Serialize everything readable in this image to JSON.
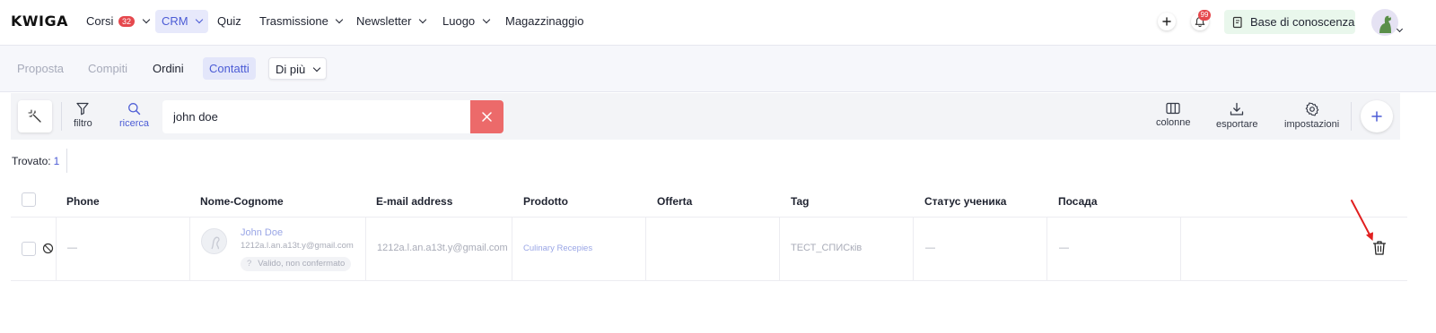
{
  "brand": {
    "logo": "KWIGA",
    "accent": "#4b5bd5",
    "danger": "#ec6a6a"
  },
  "topnav": {
    "items": [
      {
        "label": "Corsi",
        "badge": "32",
        "dropdown": true
      },
      {
        "label": "CRM",
        "dropdown": true,
        "active": true
      },
      {
        "label": "Quiz"
      },
      {
        "label": "Trasmissione",
        "dropdown": true
      },
      {
        "label": "Newsletter",
        "dropdown": true
      },
      {
        "label": "Luogo",
        "dropdown": true
      },
      {
        "label": "Magazzinaggio"
      }
    ],
    "notifications_count": "99",
    "knowledge_base_label": "Base di conoscenza"
  },
  "subnav": {
    "items": [
      "Proposta",
      "Compiti",
      "Ordini",
      "Contatti"
    ],
    "more_label": "Di più"
  },
  "toolbar": {
    "filter_label": "filtro",
    "search_label": "ricerca",
    "search_value": "john doe",
    "columns_label": "colonne",
    "export_label": "esportare",
    "settings_label": "impostazioni"
  },
  "results": {
    "found_label": "Trovato:",
    "found_count": "1"
  },
  "table": {
    "headers": [
      "Phone",
      "Nome-Cognome",
      "E-mail address",
      "Prodotto",
      "Offerta",
      "Tag",
      "Статус ученика",
      "Посада"
    ],
    "rows": [
      {
        "phone": "—",
        "name": "John Doe",
        "name_email": "1212a.l.an.a13t.y@gmail.com",
        "verification": "Valido, non confermato",
        "verification_icon": "?",
        "email": "1212a.l.an.a13t.y@gmail.com",
        "product": "Culinary Recepies",
        "offer": "",
        "tag": "ТЕСТ_СПИСків",
        "student_status": "—",
        "position": "—"
      }
    ]
  }
}
